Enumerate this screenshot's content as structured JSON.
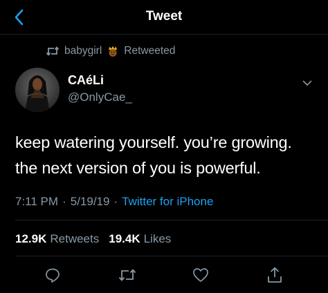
{
  "header": {
    "title": "Tweet",
    "back_icon": "chevron-left-icon"
  },
  "retweet": {
    "icon": "retweet-icon",
    "user": "babygirl",
    "emoji": "crown-face-emoji",
    "label": "Retweeted"
  },
  "author": {
    "display_name": "CAéLi",
    "handle": "@OnlyCae_"
  },
  "tweet": {
    "lines": [
      "keep watering yourself. you’re growing.",
      "the next version of you is powerful."
    ]
  },
  "meta": {
    "time": "7:11 PM",
    "sep1": "·",
    "date": "5/19/19",
    "sep2": "·",
    "source": "Twitter for iPhone"
  },
  "stats": {
    "retweets_count": "12.9K",
    "retweets_label": "Retweets",
    "likes_count": "19.4K",
    "likes_label": "Likes"
  },
  "colors": {
    "background": "#000000",
    "text_primary": "#ffffff",
    "text_secondary": "#8899a6",
    "accent": "#1da1f2",
    "divider": "#1d2228"
  }
}
